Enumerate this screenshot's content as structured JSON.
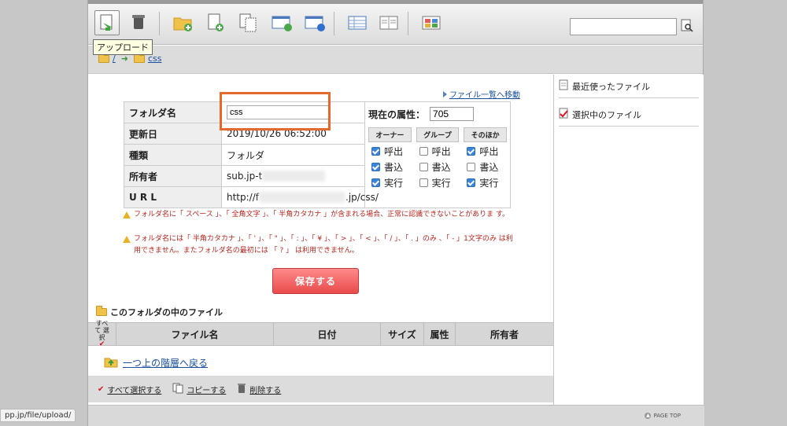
{
  "tooltip": "アップロード",
  "breadcrumb": {
    "root": "/",
    "current": "css"
  },
  "move_link": "ファイル一覧へ移動",
  "info": {
    "name_label": "フォルダ名",
    "name_value": "css",
    "date_label": "更新日",
    "date_value": "2019/10/26 06:52:00",
    "type_label": "種類",
    "type_value": "フォルダ",
    "owner_label": "所有者",
    "owner_value": "sub.jp-t",
    "url_label": "U R L",
    "url_prefix": "http://f",
    "url_suffix": ".jp/css/"
  },
  "attr": {
    "label": "現在の属性：",
    "value": "705",
    "groups": [
      "オーナー",
      "グループ",
      "そのほか"
    ],
    "perms": [
      "呼出",
      "書込",
      "実行"
    ],
    "checked": [
      [
        true,
        true,
        true
      ],
      [
        false,
        false,
        false
      ],
      [
        true,
        false,
        true
      ]
    ]
  },
  "warnings": [
    "フォルダ名に「 スペース 」、「 全角文字 」、「 半角カタカナ 」が含まれる場合、正常に認識できないことがありま す。",
    "フォルダ名には「 半角カタカナ 」、「 ' 」、「 \" 」、「 : 」、「 ¥ 」、「 > 」、「 < 」、「 / 」、「 . 」のみ 、「 - 」1文字のみ は利用できません。またフォルダ名の最初には 「 ? 」 は利用できません。"
  ],
  "save_label": "保存する",
  "folder_files_title": "このフォルダの中のファイル",
  "table_headers": {
    "select_all": "すべて 選択",
    "filename": "ファイル名",
    "date": "日付",
    "size": "サイズ",
    "attr": "属性",
    "owner": "所有者"
  },
  "up_link": "一つ上の階層へ戻る",
  "bottom_actions": {
    "select_all": "すべて選択する",
    "copy": "コピーする",
    "delete": "削除する"
  },
  "right_panel": {
    "recent": "最近使ったファイル",
    "selected": "選択中のファイル"
  },
  "footer": {
    "page_top": "PAGE TOP"
  },
  "status_url": "pp.jp/file/upload/"
}
